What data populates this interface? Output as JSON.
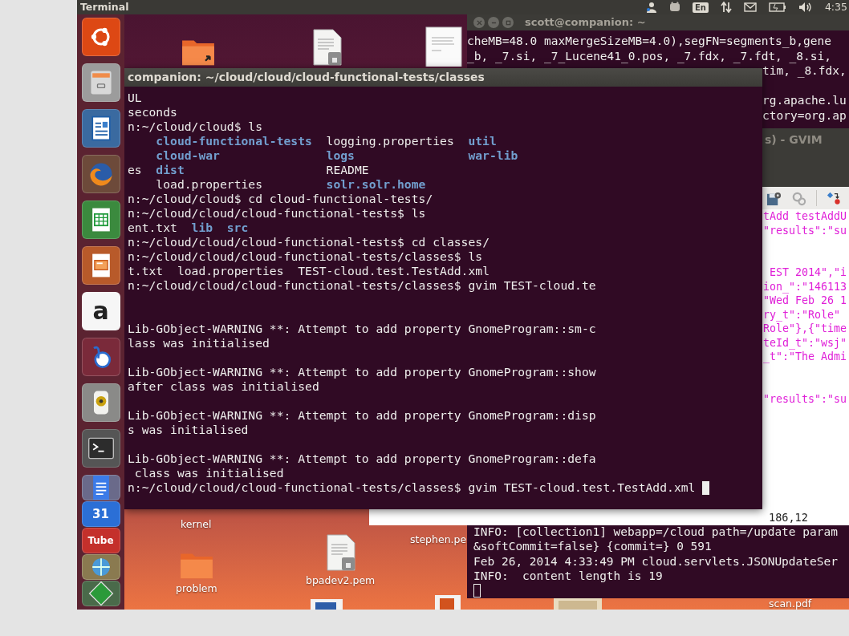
{
  "top_panel": {
    "title": "Terminal",
    "keyboard_layout": "En",
    "clock": "4:35"
  },
  "launcher": {
    "items": [
      {
        "kind": "ubuntu"
      },
      {
        "kind": "files"
      },
      {
        "kind": "writer"
      },
      {
        "kind": "firefox"
      },
      {
        "kind": "calc"
      },
      {
        "kind": "impress"
      },
      {
        "kind": "store",
        "label": "a"
      },
      {
        "kind": "bluefish"
      },
      {
        "kind": "speaker"
      },
      {
        "kind": "terminal"
      },
      {
        "kind": "docs"
      },
      {
        "kind": "calendar",
        "label": "31"
      },
      {
        "kind": "video",
        "label": "Tube"
      },
      {
        "kind": "globe"
      },
      {
        "kind": "vim"
      }
    ]
  },
  "desktop": {
    "icons": [
      {
        "kind": "folder-shortcut"
      },
      {
        "kind": "locked-file"
      },
      {
        "kind": "document-page"
      },
      {
        "kind": "label",
        "label": "kernel"
      },
      {
        "kind": "folder",
        "label": "problem"
      },
      {
        "kind": "locked-file",
        "label": "bpadev2.pem"
      },
      {
        "kind": "label",
        "label": "stephen.pe"
      },
      {
        "kind": "word-document"
      },
      {
        "kind": "presentation"
      },
      {
        "kind": "image-thumbnail"
      },
      {
        "kind": "label",
        "label": "scan.pdf"
      }
    ]
  },
  "back_terminal": {
    "title": "scott@companion: ~",
    "top_lines": [
      "cheMB=48.0 maxMergeSizeMB=4.0),segFN=segments_b,gene",
      "_b, _7.si, _7_Lucene41_0.pos, _7.fdx, _7.fdt, _8.si,"
    ],
    "right_blocks": [
      [
        "tim, _8.fdx,"
      ],
      [
        "rg.apache.lu",
        "ctory=org.ap"
      ]
    ],
    "bottom_lines": [
      "INFO: [collection1] webapp=/cloud path=/update param",
      "&softCommit=false} {commit=} 0 591",
      "Feb 26, 2014 4:33:49 PM cloud.servlets.JSONUpdateSer",
      "INFO:  content length is 19"
    ],
    "cursor_visible": true
  },
  "gvim": {
    "title": "s) - GVIM",
    "toolbar": [
      {
        "kind": "save-settings"
      },
      {
        "kind": "gears"
      },
      {
        "kind": "separator"
      },
      {
        "kind": "diff"
      }
    ],
    "blocks": [
      [
        "tAdd testAddU",
        "\"results\":\"su"
      ],
      [
        " EST 2014\",\"i",
        "ion_\":\"146113",
        "\"Wed Feb 26 1",
        "ry_t\":\"Role\"",
        "Role\"},{\"time",
        "teId_t\":\"wsj\"",
        "_t\":\"The Admi"
      ],
      [
        "\"results\":\"su"
      ]
    ],
    "ruler": "186,12"
  },
  "main_terminal": {
    "title": "companion: ~/cloud/cloud/cloud-functional-tests/classes",
    "cursor_visible": true,
    "blocks": [
      [
        [
          {
            "text": "UL",
            "kind": "plain"
          }
        ],
        [
          {
            "text": "seconds",
            "kind": "plain"
          }
        ],
        [
          {
            "text": "n:~/cloud/cloud$ ls",
            "kind": "plain"
          }
        ],
        {
          "kind": "listing",
          "cells": [
            null,
            {
              "text": "cloud-functional-tests",
              "kind": "directory"
            },
            {
              "text": "logging.properties",
              "kind": "plain"
            },
            {
              "text": "util",
              "kind": "directory"
            }
          ]
        },
        {
          "kind": "listing",
          "cells": [
            null,
            {
              "text": "cloud-war",
              "kind": "directory"
            },
            {
              "text": "logs",
              "kind": "directory"
            },
            {
              "text": "war-lib",
              "kind": "directory"
            }
          ]
        },
        {
          "kind": "listing",
          "cells": [
            {
              "text": "es",
              "kind": "plain"
            },
            {
              "text": "dist",
              "kind": "directory"
            },
            {
              "text": "README",
              "kind": "plain"
            },
            null
          ]
        },
        {
          "kind": "listing",
          "cells": [
            null,
            {
              "text": "load.properties",
              "kind": "plain"
            },
            {
              "text": "solr.solr.home",
              "kind": "directory"
            },
            null
          ]
        },
        [
          {
            "text": "n:~/cloud/cloud$ cd cloud-functional-tests/",
            "kind": "plain"
          }
        ],
        [
          {
            "text": "n:~/cloud/cloud/cloud-functional-tests$ ls",
            "kind": "plain"
          }
        ],
        {
          "kind": "short_listing",
          "cells": [
            {
              "text": "ent.txt",
              "kind": "plain"
            },
            {
              "text": "lib",
              "kind": "directory"
            },
            {
              "text": "src",
              "kind": "directory"
            }
          ]
        },
        [
          {
            "text": "n:~/cloud/cloud/cloud-functional-tests$ cd classes/",
            "kind": "plain"
          }
        ],
        [
          {
            "text": "n:~/cloud/cloud/cloud-functional-tests/classes$ ls",
            "kind": "plain"
          }
        ],
        [
          {
            "text": "t.txt  load.properties  TEST-cloud.test.TestAdd.xml",
            "kind": "plain"
          }
        ],
        [
          {
            "text": "n:~/cloud/cloud/cloud-functional-tests/classes$ gvim TEST-cloud.te",
            "kind": "plain"
          }
        ]
      ],
      [
        [
          {
            "text": "Lib-GObject-WARNING **: Attempt to add property GnomeProgram::sm-c",
            "kind": "plain"
          }
        ],
        [
          {
            "text": "lass was initialised",
            "kind": "plain"
          }
        ]
      ],
      [
        [
          {
            "text": "Lib-GObject-WARNING **: Attempt to add property GnomeProgram::show",
            "kind": "plain"
          }
        ],
        [
          {
            "text": "after class was initialised",
            "kind": "plain"
          }
        ]
      ],
      [
        [
          {
            "text": "Lib-GObject-WARNING **: Attempt to add property GnomeProgram::disp",
            "kind": "plain"
          }
        ],
        [
          {
            "text": "s was initialised",
            "kind": "plain"
          }
        ]
      ],
      [
        [
          {
            "text": "Lib-GObject-WARNING **: Attempt to add property GnomeProgram::defa",
            "kind": "plain"
          }
        ],
        [
          {
            "text": " class was initialised",
            "kind": "plain"
          }
        ],
        [
          {
            "text": "n:~/cloud/cloud/cloud-functional-tests/classes$ gvim TEST-cloud.test.TestAdd.xml",
            "kind": "plain"
          }
        ]
      ]
    ]
  }
}
